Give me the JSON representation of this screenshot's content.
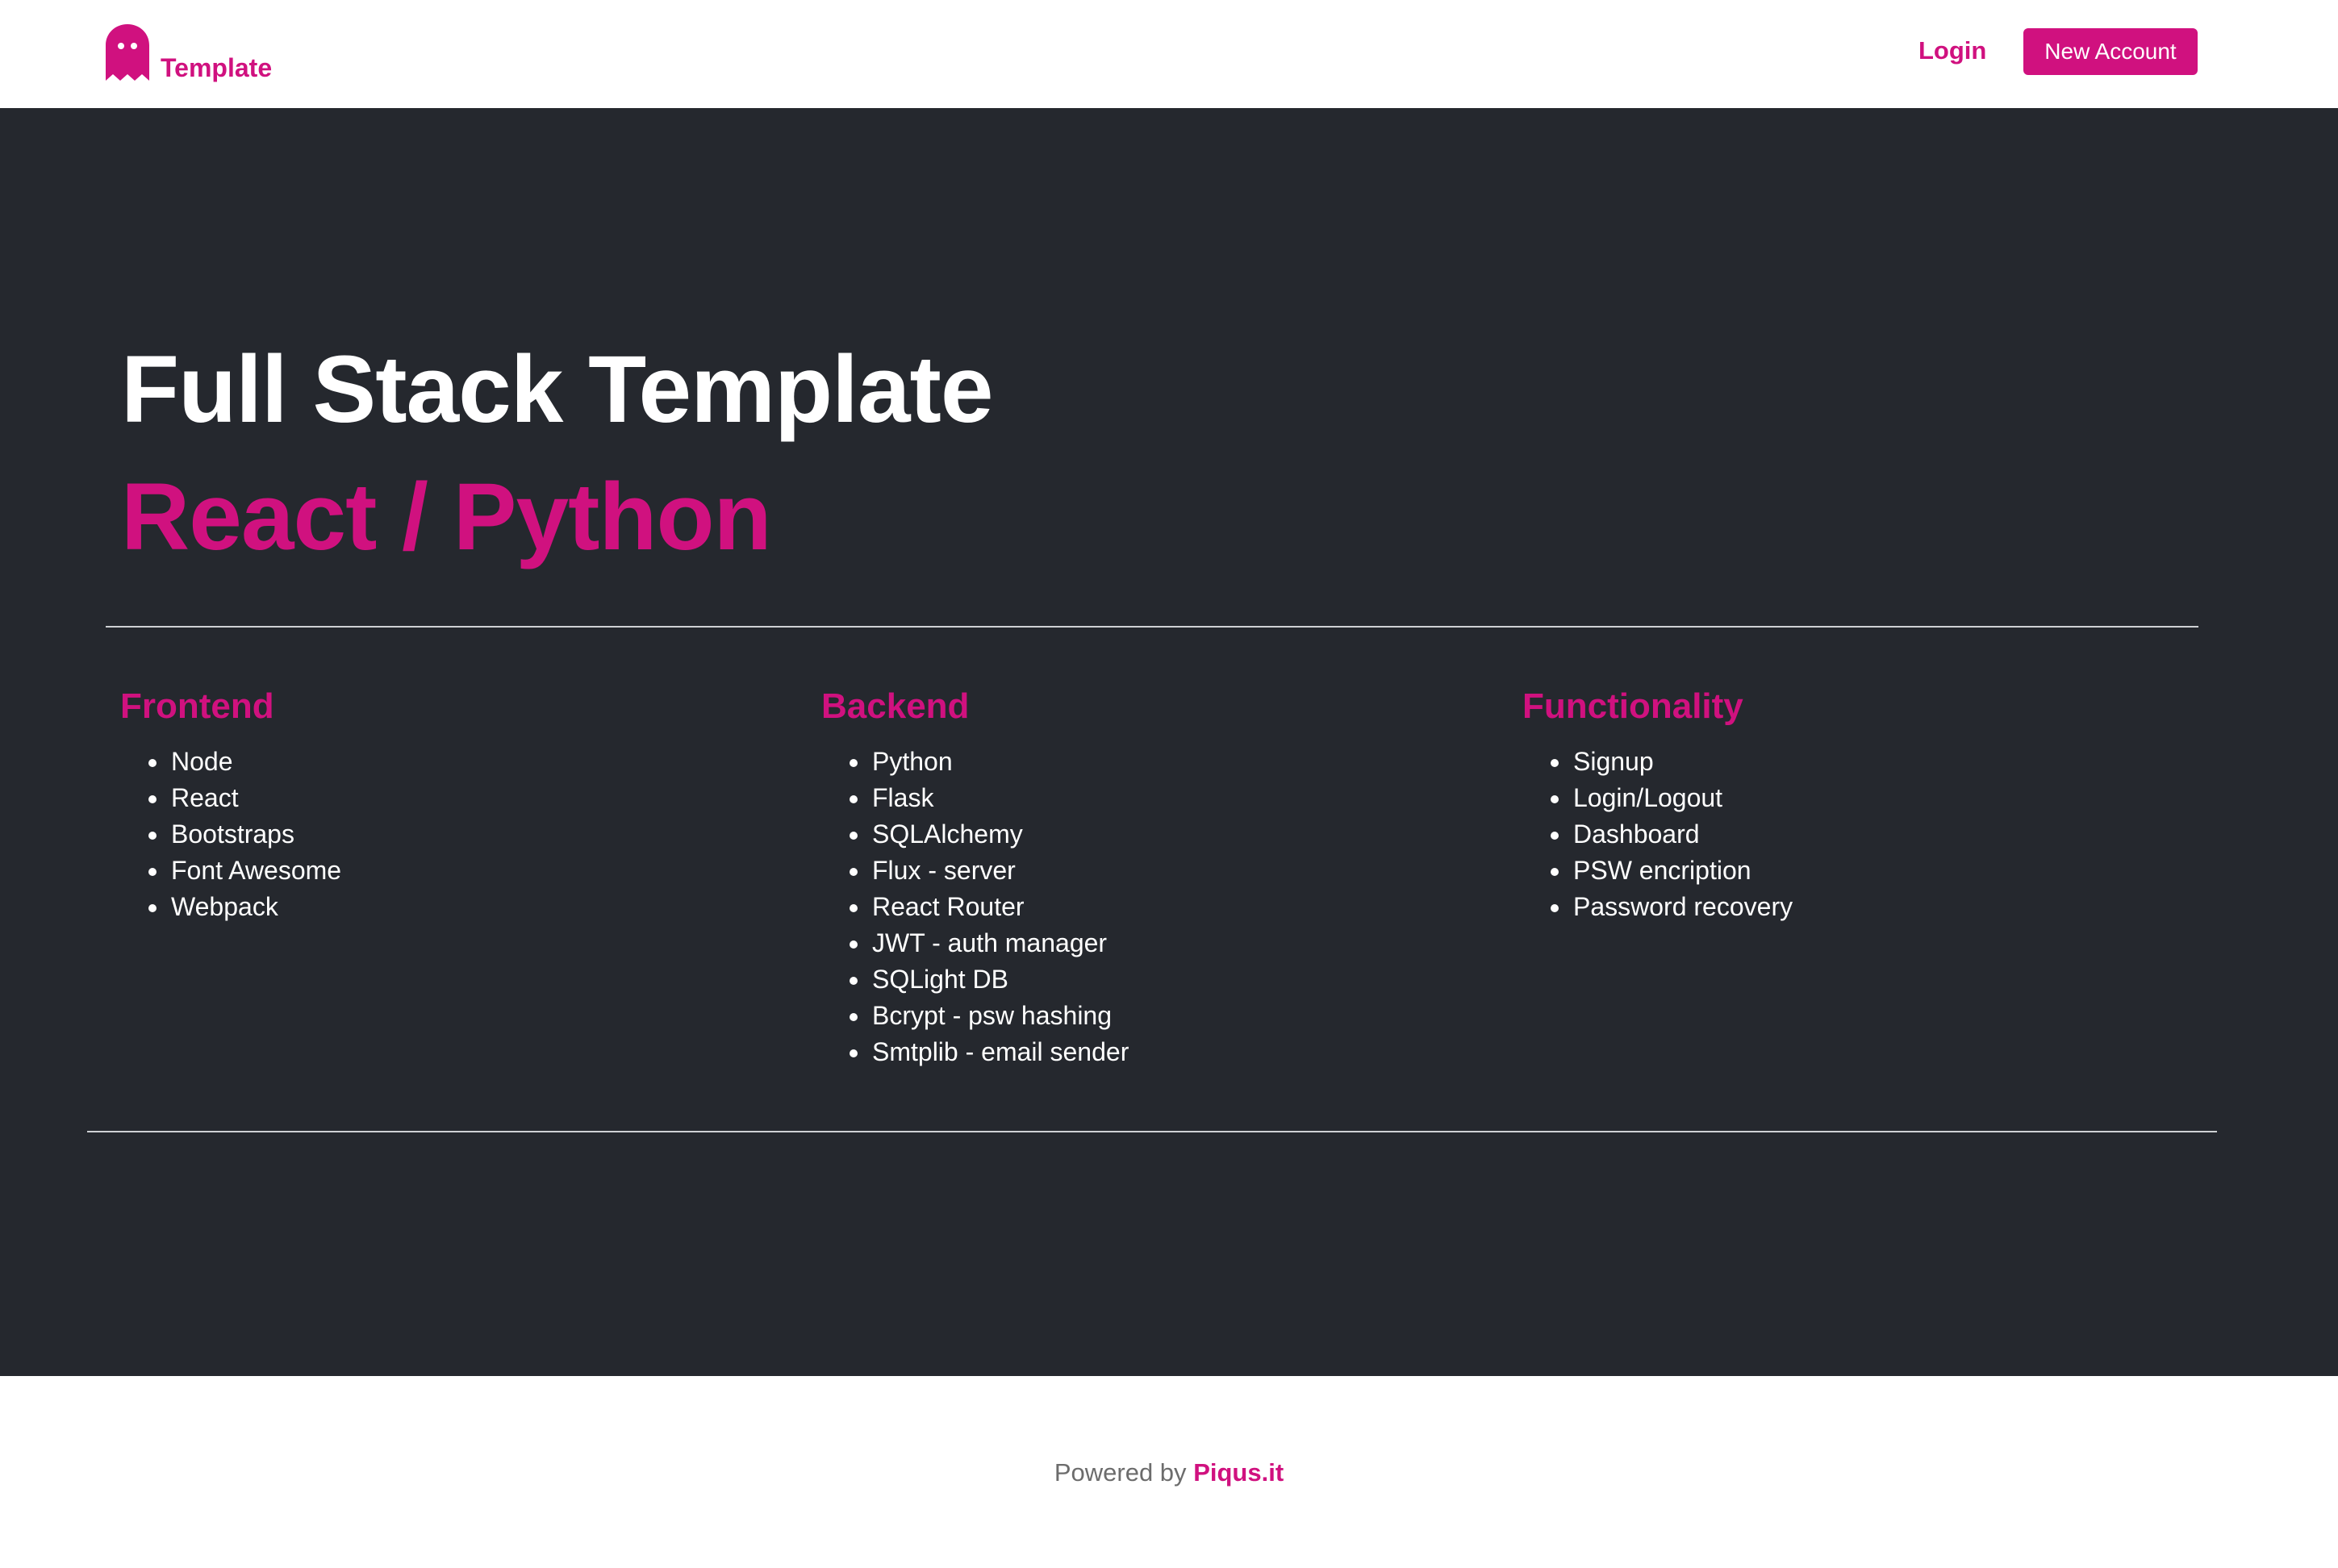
{
  "colors": {
    "brand": "#d0117f",
    "hero_bg": "#25282e",
    "text_light": "#ffffff",
    "footer_text": "#6c6c6c"
  },
  "navbar": {
    "brand_icon": "ghost-icon",
    "brand_label": "Template",
    "login_label": "Login",
    "new_account_label": "New Account"
  },
  "hero": {
    "title": "Full Stack Template",
    "subtitle": "React / Python"
  },
  "columns": [
    {
      "title": "Frontend",
      "items": [
        "Node",
        "React",
        "Bootstraps",
        "Font Awesome",
        "Webpack"
      ]
    },
    {
      "title": "Backend",
      "items": [
        "Python",
        "Flask",
        "SQLAlchemy",
        "Flux - server",
        "React Router",
        "JWT - auth manager",
        "SQLight DB",
        "Bcrypt - psw hashing",
        "Smtplib - email sender"
      ]
    },
    {
      "title": "Functionality",
      "items": [
        "Signup",
        "Login/Logout",
        "Dashboard",
        "PSW encription",
        "Password recovery"
      ]
    }
  ],
  "footer": {
    "powered_by": "Powered by",
    "link_label": "Piqus.it"
  }
}
